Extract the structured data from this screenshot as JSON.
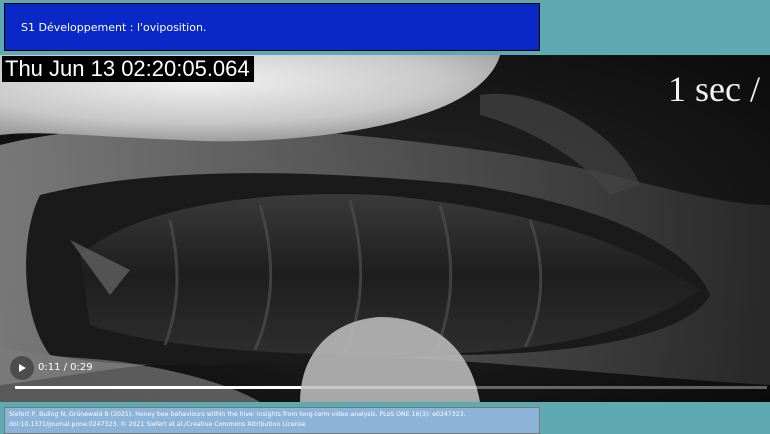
{
  "header": {
    "title": "S1 Développement : l'oviposition."
  },
  "video": {
    "timestamp": "Thu Jun 13 02:20:05.064",
    "speed_overlay": "1 sec /",
    "time_display": "0:11 / 0:29",
    "progress_fraction": 0.38,
    "play_icon": "play-icon"
  },
  "footer": {
    "credit": "Siefert P, Buling N, Grünewald B (2021). Honey bee behaviours within the hive: Insights from long-term video analysis. PLoS ONE 16(3): e0247323. doi:10.1371/journal.pone.0247323. © 2021 Siefert et al./Creative Commons Attribution License"
  },
  "colors": {
    "page_background": "#5fa9b0",
    "title_background": "#0a28c8",
    "credit_background": "#8cb4d8"
  }
}
